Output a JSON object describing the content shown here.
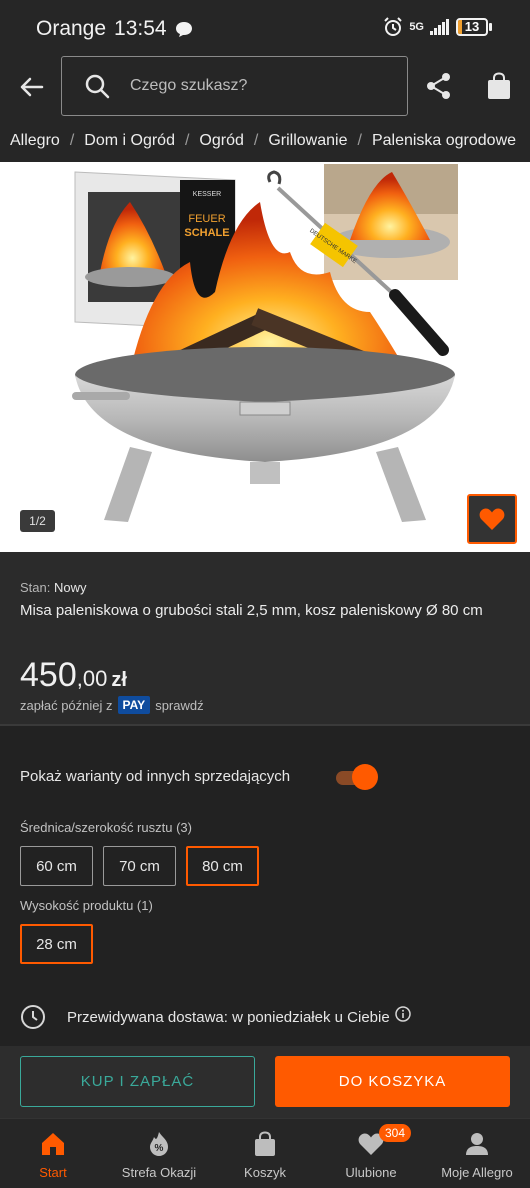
{
  "status_bar": {
    "carrier": "Orange",
    "time": "13:54",
    "network": "5G",
    "battery": "13",
    "battery_fraction": 0.13
  },
  "header": {
    "search_placeholder": "Czego szukasz?"
  },
  "breadcrumb": [
    "Allegro",
    "Dom i Ogród",
    "Ogród",
    "Grillowanie",
    "Paleniska ogrodowe"
  ],
  "gallery": {
    "counter": "1/2",
    "image_texts": {
      "brand": "KESSER",
      "box_line1": "FEUER",
      "box_line2": "SCHALE",
      "tag": "DEUTSCHE MARKE"
    }
  },
  "product": {
    "condition_label": "Stan:",
    "condition_value": "Nowy",
    "title": "Misa paleniskowa o grubości stali 2,5 mm, kosz paleniskowy Ø 80 cm",
    "price_integer": "450",
    "price_decimal": ",00",
    "price_currency": "zł",
    "paylater_prefix": "zapłać później z",
    "pay_badge": "PAY",
    "paylater_suffix": "sprawdź"
  },
  "variants": {
    "toggle_label": "Pokaż warianty od innych sprzedających",
    "toggle_on": true,
    "diameter_label": "Średnica/szerokość rusztu (3)",
    "diameter_options": [
      "60 cm",
      "70 cm",
      "80 cm"
    ],
    "diameter_selected": "80 cm",
    "height_label": "Wysokość produktu (1)",
    "height_options": [
      "28 cm"
    ],
    "height_selected": "28 cm"
  },
  "delivery": {
    "text": "Przewidywana dostawa: w poniedziałek u Ciebie"
  },
  "actions": {
    "buy_label": "KUP I ZAPŁAĆ",
    "cart_label": "DO KOSZYKA"
  },
  "bottom_nav": {
    "items": [
      {
        "label": "Start",
        "icon": "home-icon",
        "active": true
      },
      {
        "label": "Strefa Okazji",
        "icon": "deals-icon",
        "active": false
      },
      {
        "label": "Koszyk",
        "icon": "cart-icon",
        "active": false
      },
      {
        "label": "Ulubione",
        "icon": "heart-icon",
        "active": false,
        "badge": "304"
      },
      {
        "label": "Moje Allegro",
        "icon": "user-icon",
        "active": false
      }
    ]
  },
  "colors": {
    "accent": "#ff5a00",
    "teal": "#3aa99a",
    "background": "#222222",
    "pay_blue": "#0f4c9e"
  }
}
